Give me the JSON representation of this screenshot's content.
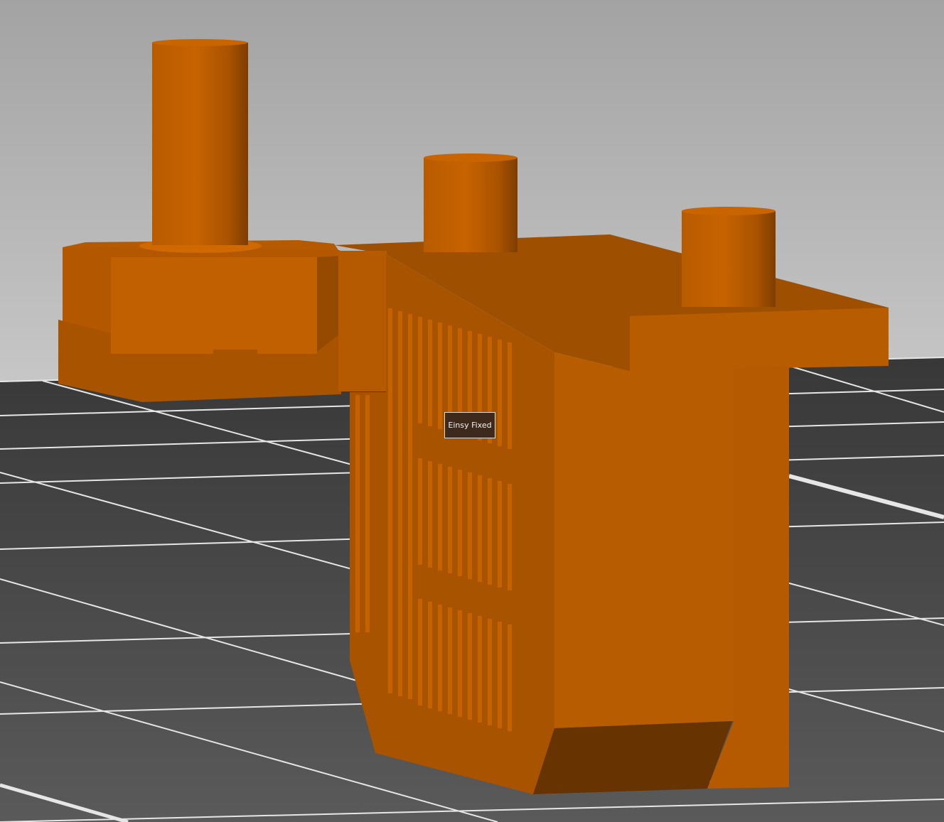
{
  "viewport": {
    "background_top": "#a3a3a3",
    "background_bottom": "#c6c6c6",
    "bed_color": "#474747",
    "grid_color": "#ffffff",
    "model_color": "#c06000"
  },
  "object_tooltip": {
    "label": "Einsy Fixed"
  }
}
